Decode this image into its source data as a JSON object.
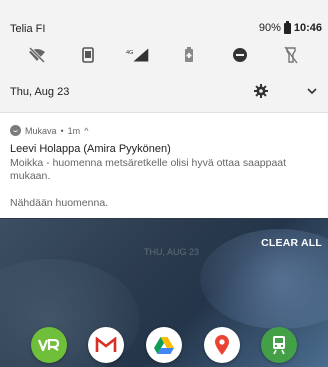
{
  "status_bar": {
    "carrier": "Telia FI",
    "battery_percent": "90%",
    "time": "10:46"
  },
  "quick_settings": {
    "icons": [
      "wifi-off-icon",
      "screen-rotate-icon",
      "signal-4g-icon",
      "battery-saver-icon",
      "do-not-disturb-icon",
      "flashlight-off-icon"
    ],
    "network_label": "4G"
  },
  "date_row": {
    "date": "Thu, Aug 23"
  },
  "notification": {
    "app_name": "Mukava",
    "separator": "•",
    "time_ago": "1m",
    "expand_glyph": "^",
    "title": "Leevi Holappa (Amira Pyykönen)",
    "body": "Moikka - huomenna metsäretkelle olisi hyvä ottaa saappaat mukaan.",
    "body_line2": "Nähdään huomenna."
  },
  "wallpaper": {
    "clear_all": "CLEAR ALL",
    "ghost_date": "THU, AUG 23"
  },
  "dock": {
    "apps": [
      "vr-app-icon",
      "gmail-app-icon",
      "drive-app-icon",
      "maps-app-icon",
      "train-app-icon"
    ]
  },
  "colors": {
    "accent": "#2e7d32",
    "shade_bg": "#f3f3f3",
    "text_dark": "#222222",
    "text_muted": "#666666"
  }
}
